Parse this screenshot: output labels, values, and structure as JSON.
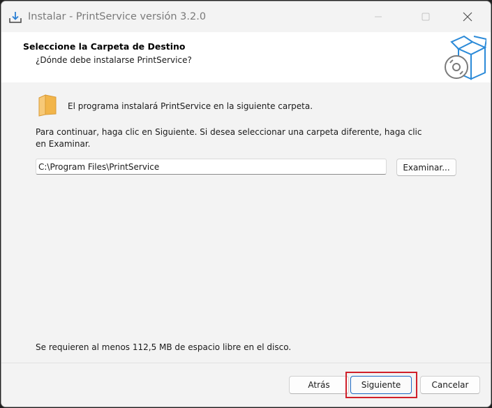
{
  "window": {
    "title": "Instalar - PrintService versión 3.2.0"
  },
  "header": {
    "heading": "Seleccione la Carpeta de Destino",
    "subheading": "¿Dónde debe instalarse PrintService?"
  },
  "content": {
    "folder_text": "El programa instalará PrintService en la siguiente carpeta.",
    "instruction": "Para continuar, haga clic en Siguiente. Si desea seleccionar una carpeta diferente, haga clic en Examinar.",
    "path_value": "C:\\Program Files\\PrintService",
    "browse_label": "Examinar...",
    "space_text": "Se requieren al menos 112,5 MB de espacio libre en el disco."
  },
  "footer": {
    "back_label": "Atrás",
    "next_label": "Siguiente",
    "cancel_label": "Cancelar"
  },
  "colors": {
    "accent": "#1f6bc4",
    "highlight": "#d0202a",
    "folder": "#f2b54a"
  },
  "icons": [
    "installer-icon",
    "minimize-icon",
    "maximize-icon",
    "close-icon",
    "software-box-icon",
    "folder-icon"
  ]
}
